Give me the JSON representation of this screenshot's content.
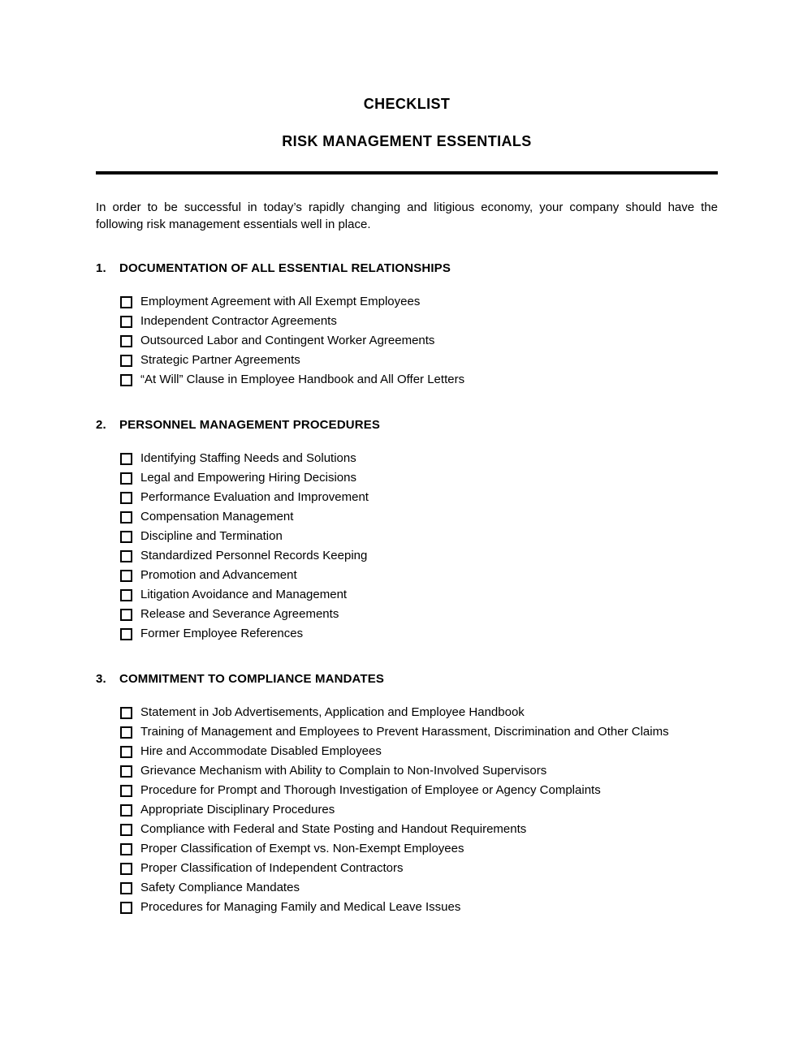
{
  "document": {
    "title": "CHECKLIST",
    "subtitle": "RISK MANAGEMENT ESSENTIALS",
    "intro": "In order to be successful in today’s rapidly changing and litigious economy, your company should have the following risk management essentials well in place.",
    "sections": [
      {
        "number": "1.",
        "title": "DOCUMENTATION OF ALL ESSENTIAL RELATIONSHIPS",
        "items": [
          "Employment Agreement with All Exempt Employees",
          "Independent Contractor Agreements",
          "Outsourced Labor and Contingent Worker Agreements",
          "Strategic Partner Agreements",
          "“At Will” Clause in Employee Handbook and All Offer Letters"
        ]
      },
      {
        "number": "2.",
        "title": "PERSONNEL MANAGEMENT PROCEDURES",
        "items": [
          "Identifying Staffing Needs and Solutions",
          "Legal and Empowering Hiring Decisions",
          "Performance Evaluation and Improvement",
          "Compensation Management",
          "Discipline and Termination",
          "Standardized Personnel Records Keeping",
          "Promotion and Advancement",
          "Litigation Avoidance and Management",
          "Release and Severance Agreements",
          "Former Employee References"
        ]
      },
      {
        "number": "3.",
        "title": "COMMITMENT TO COMPLIANCE MANDATES",
        "items": [
          "Statement in Job Advertisements, Application and Employee Handbook",
          "Training of Management and Employees to Prevent Harassment, Discrimination and Other Claims",
          "Hire and Accommodate Disabled Employees",
          "Grievance Mechanism with Ability to Complain to Non-Involved Supervisors",
          "Procedure for Prompt and Thorough Investigation of Employee or Agency Complaints",
          "Appropriate Disciplinary Procedures",
          "Compliance with Federal and State Posting and Handout Requirements",
          "Proper Classification of Exempt vs. Non-Exempt Employees",
          "Proper Classification of Independent Contractors",
          "Safety Compliance Mandates",
          "Procedures for Managing Family and Medical Leave Issues"
        ]
      }
    ]
  },
  "colors": {
    "text": "#000000",
    "page_background": "#ffffff",
    "rule": "#000000"
  },
  "icons": {
    "checkbox": "checkbox-unchecked-shadowed"
  }
}
